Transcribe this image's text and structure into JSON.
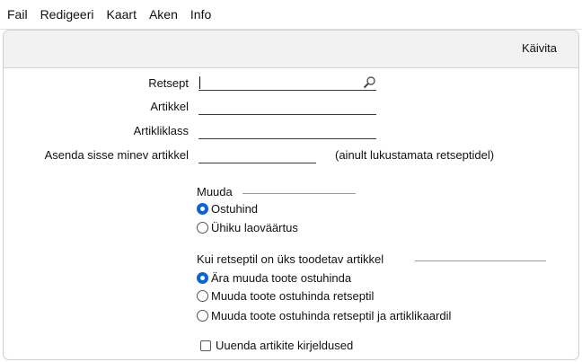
{
  "menu": [
    "Fail",
    "Redigeeri",
    "Kaart",
    "Aken",
    "Info"
  ],
  "toolbar": {
    "run_label": "Käivita"
  },
  "form": {
    "recipe_label": "Retsept",
    "recipe_value": "",
    "item_label": "Artikkel",
    "item_value": "",
    "item_class_label": "Artikliklass",
    "item_class_value": "",
    "replace_label": "Asenda sisse minev artikkel",
    "replace_value": "",
    "replace_note": "(ainult lukustamata retseptidel)"
  },
  "change_group": {
    "title": "Muuda",
    "options": [
      "Ostuhind",
      "Ühiku laoväärtus"
    ],
    "selected": 0
  },
  "single_group": {
    "title": "Kui retseptil on üks toodetav artikkel",
    "options": [
      "Ära muuda toote ostuhinda",
      "Muuda toote ostuhinda retseptil",
      "Muuda toote ostuhinda retseptil ja artiklikaardil"
    ],
    "selected": 0
  },
  "update_descriptions": {
    "label": "Uuenda artikite kirjeldused",
    "checked": false
  }
}
